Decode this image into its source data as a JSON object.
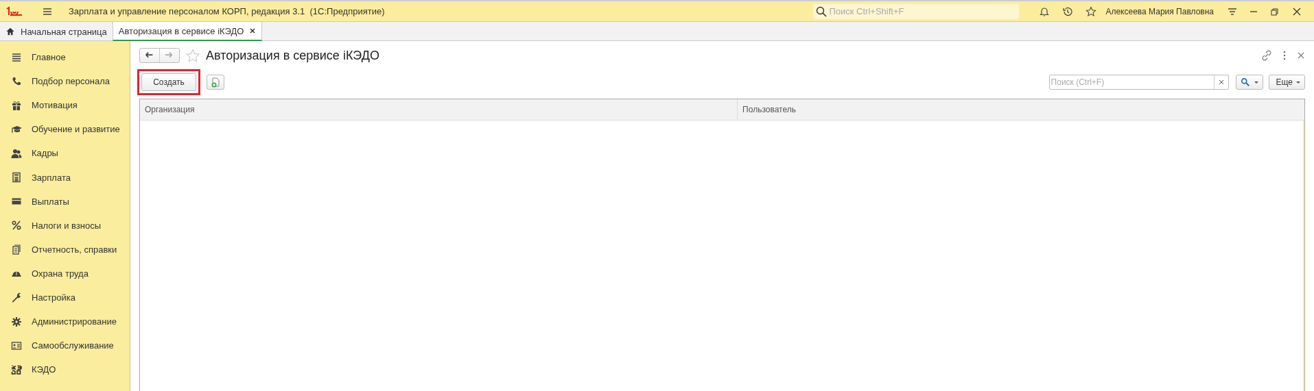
{
  "window": {
    "title": "Зарплата и управление персоналом КОРП, редакция 3.1  (1С:Предприятие)",
    "search": {
      "placeholder": "Поиск Ctrl+Shift+F"
    },
    "user": "Алексеева Мария Павловна"
  },
  "tabs": [
    {
      "label": "Начальная страница",
      "selected": false
    },
    {
      "label": "Авторизация в сервисе iКЭДО",
      "selected": true
    }
  ],
  "sidebar": {
    "items": [
      {
        "label": "Главное"
      },
      {
        "label": "Подбор персонала"
      },
      {
        "label": "Мотивация"
      },
      {
        "label": "Обучение и развитие"
      },
      {
        "label": "Кадры"
      },
      {
        "label": "Зарплата"
      },
      {
        "label": "Выплаты"
      },
      {
        "label": "Налоги и взносы"
      },
      {
        "label": "Отчетность, справки"
      },
      {
        "label": "Охрана труда"
      },
      {
        "label": "Настройка"
      },
      {
        "label": "Администрирование"
      },
      {
        "label": "Самообслуживание"
      },
      {
        "label": "КЭДО"
      }
    ]
  },
  "form": {
    "title": "Авторизация в сервисе iКЭДО",
    "favorite": false,
    "create_button": {
      "label": "Создать",
      "highlighted": true
    },
    "search": {
      "placeholder": "Поиск (Ctrl+F)"
    },
    "more_button": "Еще",
    "table": {
      "columns": [
        "Организация",
        "Пользователь"
      ]
    }
  }
}
